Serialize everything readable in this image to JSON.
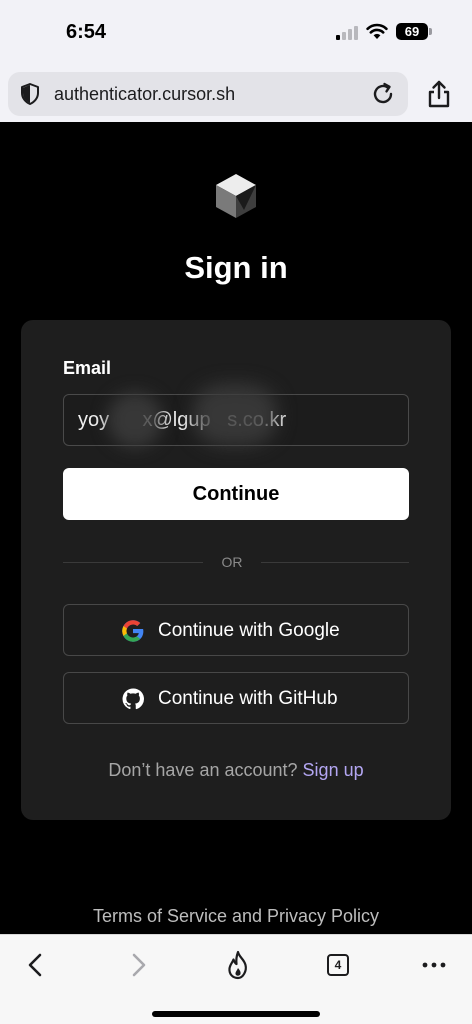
{
  "status_bar": {
    "time": "6:54",
    "battery": "69"
  },
  "browser": {
    "url": "authenticator.cursor.sh",
    "tab_count": "4"
  },
  "page": {
    "title": "Sign in",
    "email_label": "Email",
    "email_value": "yoy      x@lgup   s.co.kr",
    "continue_label": "Continue",
    "or_label": "OR",
    "google_label": "Continue with Google",
    "github_label": "Continue with GitHub",
    "signup_prompt": "Don’t have an account?",
    "signup_link": "Sign up",
    "terms": "Terms of Service and Privacy Policy"
  },
  "icons": {
    "logo": "cursor-logo-icon",
    "shield": "shield-icon",
    "reload": "reload-icon",
    "share": "share-icon",
    "google": "google-icon",
    "github": "github-icon",
    "back": "back-chevron-icon",
    "forward": "forward-chevron-icon",
    "fire": "fire-icon",
    "tabs": "tabs-icon",
    "more": "more-dots-icon"
  },
  "colors": {
    "page_bg": "#000000",
    "card_bg": "#1e1e1e",
    "link": "#b3a6f2",
    "button_bg": "#ffffff"
  }
}
